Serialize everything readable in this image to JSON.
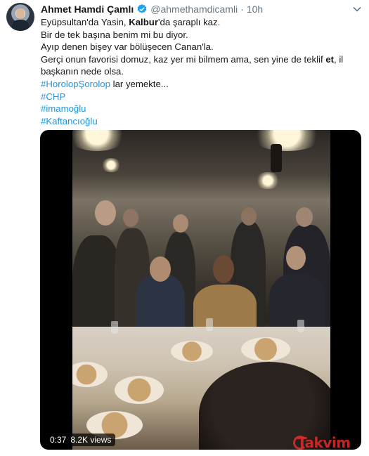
{
  "tweet": {
    "author_name": "Ahmet Hamdi Çamlı",
    "handle": "@ahmethamdicamli",
    "separator": "·",
    "time": "10h",
    "lines": {
      "l1a": "Eyüpsultan'da Yasin, ",
      "l1b": "Kalbur",
      "l1c": "'da şaraplı kaz.",
      "l2": "Bir de tek başına benim mi bu diyor.",
      "l3": "Ayıp denen bişey var bölüşecen Canan'la.",
      "l4a": "Gerçi onun favorisi domuz, kaz yer mi bilmem ama, sen yine de teklif ",
      "l4b": "et",
      "l4c": ", il",
      "l5": "başkanın nede olsa.",
      "l6a": "#HorolopŞorolop",
      "l6b": " lar yemekte...",
      "h1": "#CHP",
      "h2": "#imamoğlu",
      "h3": "#Kaftancıoğlu"
    }
  },
  "video": {
    "duration": "0:37",
    "views": "8.2K views",
    "watermark": "Takvim"
  },
  "colors": {
    "text": "#14171a",
    "secondary": "#657786",
    "link": "#1b95e0",
    "verified": "#1da1f2",
    "watermark": "#e22c2c"
  },
  "icons": {
    "verified": "verified-badge-icon",
    "menu": "chevron-down-icon"
  }
}
